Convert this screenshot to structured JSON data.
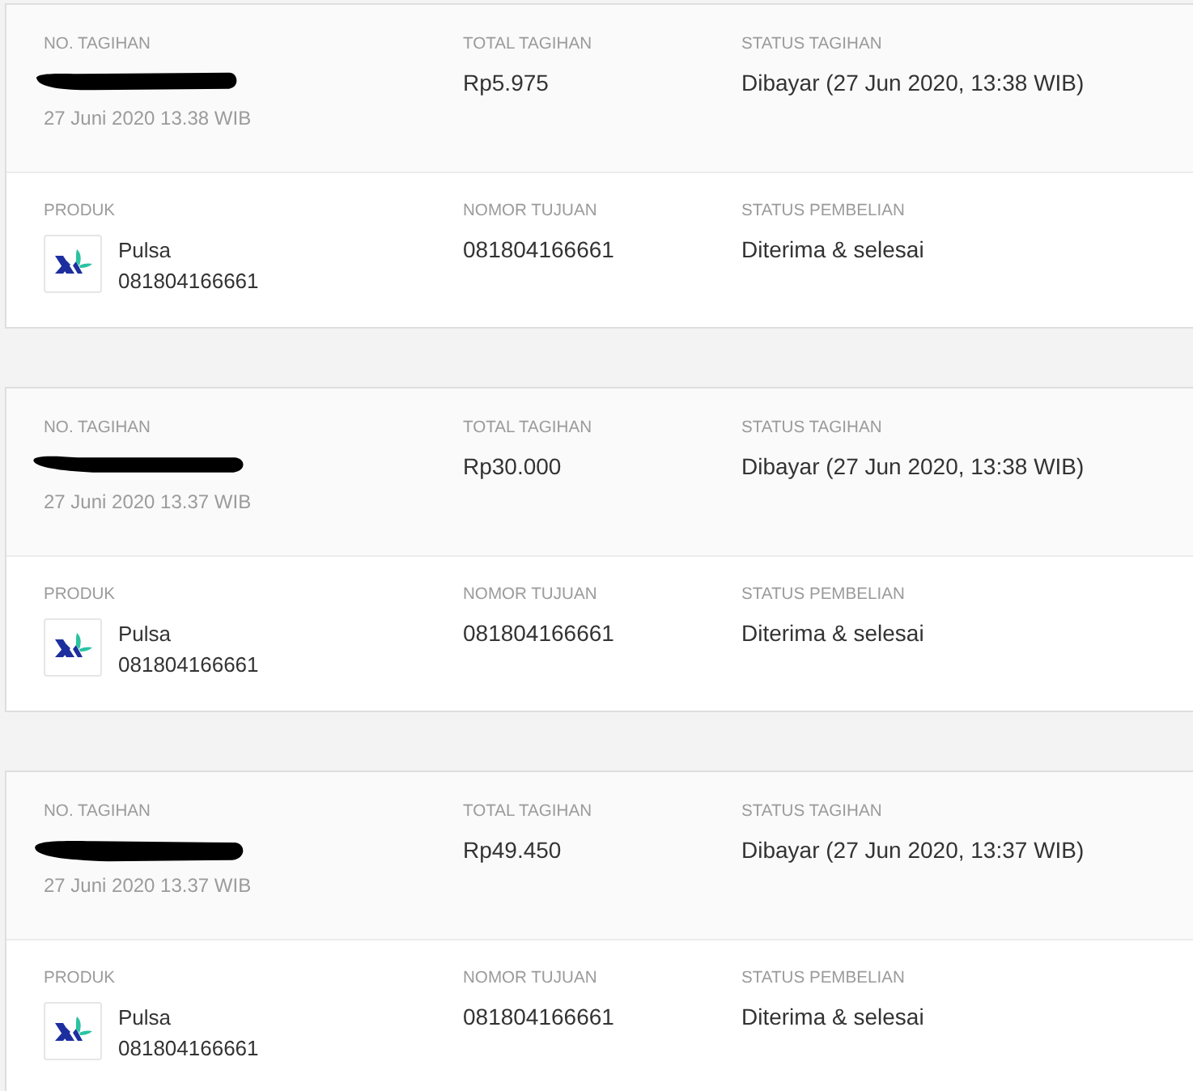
{
  "orders": [
    {
      "header": {
        "invoice_label": "NO. TAGIHAN",
        "date": "27 Juni 2020 13.38 WIB",
        "total_label": "TOTAL TAGIHAN",
        "total": "Rp5.975",
        "status_label": "STATUS TAGIHAN",
        "status": "Dibayar (27 Jun 2020, 13:38 WIB)"
      },
      "body": {
        "product_label": "PRODUK",
        "product_name": "Pulsa",
        "product_number": "081804166661",
        "target_label": "NOMOR TUJUAN",
        "target": "081804166661",
        "purchase_status_label": "STATUS PEMBELIAN",
        "purchase_status": "Diterima & selesai"
      }
    },
    {
      "header": {
        "invoice_label": "NO. TAGIHAN",
        "date": "27 Juni 2020 13.37 WIB",
        "total_label": "TOTAL TAGIHAN",
        "total": "Rp30.000",
        "status_label": "STATUS TAGIHAN",
        "status": "Dibayar (27 Jun 2020, 13:38 WIB)"
      },
      "body": {
        "product_label": "PRODUK",
        "product_name": "Pulsa",
        "product_number": "081804166661",
        "target_label": "NOMOR TUJUAN",
        "target": "081804166661",
        "purchase_status_label": "STATUS PEMBELIAN",
        "purchase_status": "Diterima & selesai"
      }
    },
    {
      "header": {
        "invoice_label": "NO. TAGIHAN",
        "date": "27 Juni 2020 13.37 WIB",
        "total_label": "TOTAL TAGIHAN",
        "total": "Rp49.450",
        "status_label": "STATUS TAGIHAN",
        "status": "Dibayar (27 Jun 2020, 13:37 WIB)"
      },
      "body": {
        "product_label": "PRODUK",
        "product_name": "Pulsa",
        "product_number": "081804166661",
        "target_label": "NOMOR TUJUAN",
        "target": "081804166661",
        "purchase_status_label": "STATUS PEMBELIAN",
        "purchase_status": "Diterima & selesai"
      }
    }
  ]
}
